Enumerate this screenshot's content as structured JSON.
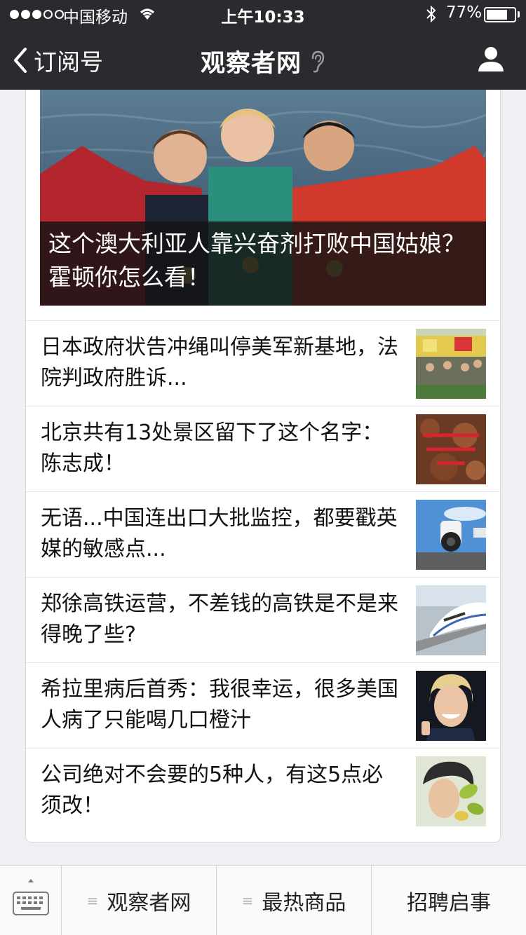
{
  "status_bar": {
    "carrier": "中国移动",
    "time": "上午10:33",
    "battery_percent": "77%",
    "battery_level": 0.77,
    "signal_bars_filled": 3,
    "signal_bars_total": 5
  },
  "nav": {
    "back_label": "订阅号",
    "title": "观察者网",
    "back_icon": "chevron-left-icon",
    "title_icon": "ear-icon",
    "profile_icon": "person-icon"
  },
  "hero": {
    "caption": "这个澳大利亚人靠兴奋剂打败中国姑娘？霍顿你怎么看！"
  },
  "articles": [
    {
      "title": "日本政府状告冲绳叫停美军新基地，法院判政府胜诉..."
    },
    {
      "title": "北京共有13处景区留下了这个名字：陈志成！"
    },
    {
      "title": "无语...中国连出口大批监控，都要戳英媒的敏感点..."
    },
    {
      "title": "郑徐高铁运营，不差钱的高铁是不是来得晚了些?"
    },
    {
      "title": "希拉里病后首秀：我很幸运，很多美国人病了只能喝几口橙汁"
    },
    {
      "title": "公司绝对不会要的5种人，有这5点必须改！"
    }
  ],
  "menu": {
    "keyboard_icon": "keyboard-icon",
    "items": [
      {
        "label": "观察者网",
        "icon": "≡"
      },
      {
        "label": "最热商品",
        "icon": "≡"
      },
      {
        "label": "招聘启事"
      }
    ]
  },
  "colors": {
    "topbar": "#2b2b2f",
    "background": "#efeff4",
    "card": "#ffffff"
  }
}
